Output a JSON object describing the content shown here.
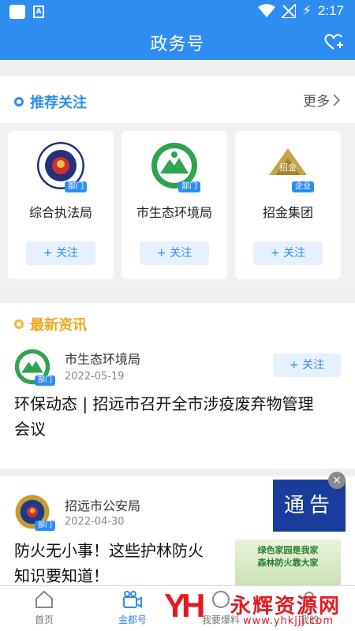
{
  "status": {
    "time": "2:17",
    "battery": "⚡"
  },
  "header": {
    "title": "政务号"
  },
  "recommend": {
    "title": "推荐关注",
    "more": "更多",
    "cards": [
      {
        "name": "综合执法局",
        "tag": "部门",
        "follow": "+ 关注"
      },
      {
        "name": "市生态环境局",
        "tag": "部门",
        "follow": "+ 关注"
      },
      {
        "name": "招金集团",
        "tag": "企业",
        "follow": "+ 关注",
        "logo_text": "招金"
      }
    ]
  },
  "news": {
    "title": "最新资讯",
    "items": [
      {
        "author": "市生态环境局",
        "tag": "部门",
        "date": "2022-05-19",
        "follow": "+ 关注",
        "headline1": "环保动态 | 招远市召开全市涉疫废弃物管理",
        "headline2": "会议"
      },
      {
        "author": "招远市公安局",
        "tag": "部门",
        "date": "2022-04-30",
        "headline1": "防火无小事！这些护林防火",
        "headline2": "知识要知道！",
        "thumb1": "绿色家园是我家",
        "thumb2": "森林防火靠大家"
      }
    ]
  },
  "notice": {
    "label": "通告",
    "close": "×"
  },
  "tabs": [
    {
      "label": "首页"
    },
    {
      "label": "金都号"
    },
    {
      "label": "我要爆料"
    },
    {
      "label": "我的"
    }
  ],
  "watermark": {
    "brand": "永辉资源网",
    "url": "www.yhkjjj.com"
  },
  "colors": {
    "primary": "#2f8cf0",
    "accent": "#f0a81e",
    "notice": "#1a3d9c"
  }
}
